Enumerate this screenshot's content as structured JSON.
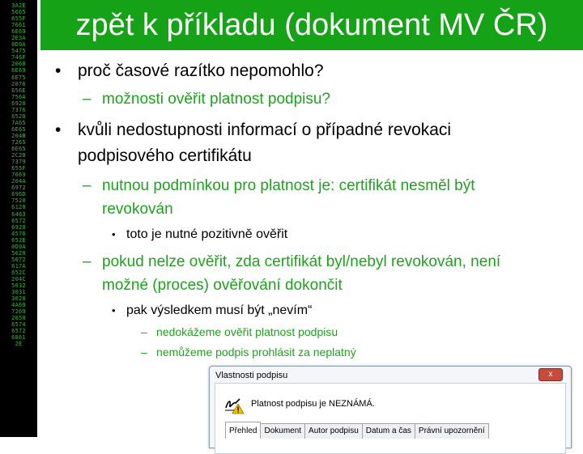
{
  "sidebar": {
    "hex_codes": [
      "3A2E",
      "5665",
      "655F",
      "7661",
      "6E69",
      "2E3A",
      "0D0A",
      "5475",
      "746F",
      "2068",
      "6E69",
      "6E75",
      "2076",
      "656E",
      "756A",
      "6920",
      "7376",
      "6520",
      "7A65",
      "6E65",
      "204B",
      "7265",
      "6E65",
      "2C20",
      "7379",
      "655F",
      "7669",
      "204A",
      "6972",
      "696D",
      "7520",
      "6120",
      "6463",
      "6572",
      "6920",
      "4576",
      "652E",
      "0D0A",
      "5620",
      "5072",
      "617A",
      "652C",
      "204C",
      "5032",
      "3031",
      "3020",
      "4A69",
      "7269",
      "2050",
      "6574",
      "6572",
      "6861",
      "2E"
    ]
  },
  "slide": {
    "title": "zpět k příkladu (dokument MV ČR)",
    "bullets": [
      {
        "text": "proč časové razítko nepomohlo?",
        "marker": "•"
      },
      {
        "text": "možnosti ověřit platnost podpisu?",
        "marker": "–"
      },
      {
        "text_line1": "kvůli nedostupnosti informací o případné revokaci",
        "text_line2": "podpisového certifikátu",
        "marker": "•"
      },
      {
        "text_line1": "nutnou podmínkou pro platnost je: certifikát nesměl být",
        "text_line2": "revokován",
        "marker": "–"
      },
      {
        "text": "toto je nutné pozitivně ověřit",
        "marker": "•"
      },
      {
        "text_line1": "pokud nelze ověřit, zda certifikát byl/nebyl revokován, není",
        "text_line2": "možné (proces) ověřování dokončit",
        "marker": "–"
      },
      {
        "text": "pak výsledkem musí být „nevím“",
        "marker": "•"
      },
      {
        "text": "nedokážeme ověřit platnost podpisu",
        "marker": "–"
      },
      {
        "text": "nemůžeme podpis prohlásit za neplatný",
        "marker": "–"
      }
    ]
  },
  "dialog": {
    "title": "Vlastnosti podpisu",
    "close_label": "x",
    "status_text": "Platnost podpisu je NEZNÁMÁ.",
    "tabs": [
      "Přehled",
      "Dokument",
      "Autor podpisu",
      "Datum a čas",
      "Právní upozornění"
    ],
    "active_tab": "Přehled"
  },
  "colors": {
    "title_bar": "#16a216",
    "sidebar_bg": "#000000",
    "hex_text": "#3cb63c",
    "subpoint_green": "#1ea21e"
  }
}
